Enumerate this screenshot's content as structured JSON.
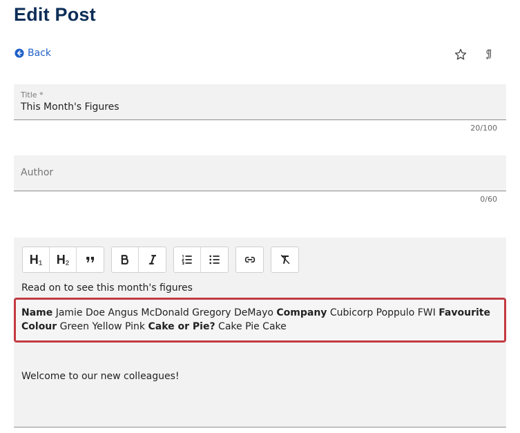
{
  "page": {
    "title": "Edit Post"
  },
  "nav": {
    "back_label": "Back"
  },
  "icons": {
    "back": "arrow-left-circle-icon",
    "star": "star-icon",
    "pilcrow": "pilcrow-icon"
  },
  "form": {
    "title": {
      "label": "Title *",
      "value": "This Month's Figures",
      "counter": "20/100"
    },
    "author": {
      "placeholder": "Author",
      "value": "",
      "counter": "0/60"
    }
  },
  "toolbar": {
    "groups": [
      [
        "heading-1",
        "heading-2",
        "blockquote"
      ],
      [
        "bold",
        "italic"
      ],
      [
        "ordered-list",
        "bullet-list"
      ],
      [
        "link"
      ],
      [
        "clear-formatting"
      ]
    ],
    "h1_letter": "H",
    "h1_sub": "1",
    "h2_letter": "H",
    "h2_sub": "2"
  },
  "editor": {
    "line1": "Read on to see this month's figures",
    "table_text": {
      "h_name": "Name",
      "names": " Jamie Doe Angus McDonald Gregory DeMayo ",
      "h_company": "Company",
      "companies": " Cubicorp Poppulo FWI ",
      "h_colour": "Favourite Colour",
      "colours": " Green Yellow Pink ",
      "h_cake": "Cake or Pie?",
      "cakes": " Cake Pie Cake"
    },
    "line3": "Welcome to our new colleagues!"
  },
  "colors": {
    "title": "#0c2d57",
    "link": "#2060c8",
    "highlight_border": "#c23a3f",
    "field_bg": "#f2f2f2"
  }
}
